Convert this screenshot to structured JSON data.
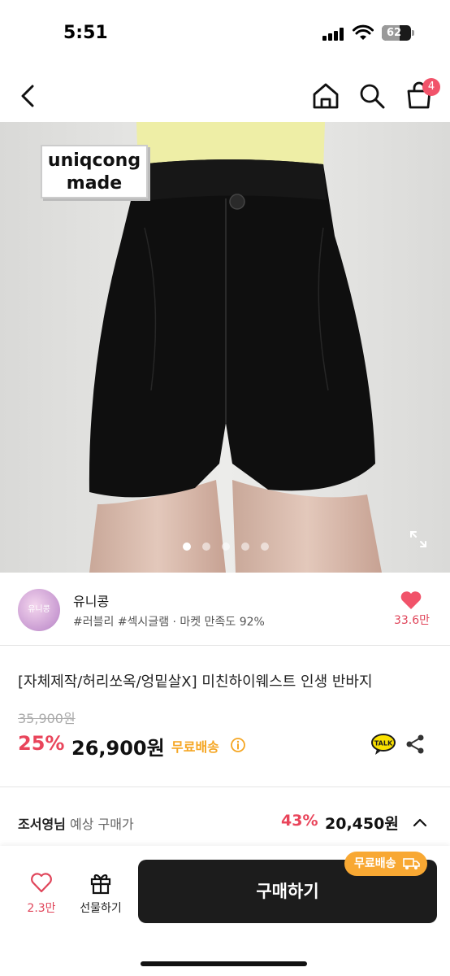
{
  "status_bar": {
    "time": "5:51",
    "battery": "62",
    "battery_level": 0.62
  },
  "nav": {
    "cart_count": "4"
  },
  "product_image": {
    "brand_line1": "uniqcong",
    "brand_line2": "made",
    "slide_count": 5,
    "active_slide": 0
  },
  "seller": {
    "avatar_text": "유니콩",
    "name": "유니콩",
    "tags": "#러블리 #섹시글램 · 마켓 만족도 92%",
    "likes": "33.6만"
  },
  "product": {
    "title": "[자체제작/허리쏘옥/엉밑살X] 미친하이웨스트 인생 반바지",
    "original_price": "35,900원",
    "discount": "25%",
    "price": "26,900원",
    "shipping": "무료배송"
  },
  "member_price": {
    "name": "조서영님",
    "label": "예상 구매가",
    "discount": "43%",
    "price": "20,450원"
  },
  "bottom_bar": {
    "wish_count": "2.3만",
    "gift_label": "선물하기",
    "buy_label": "구매하기",
    "free_badge": "무료배송"
  },
  "colors": {
    "accent_red": "#e9455b",
    "shipping_orange": "#f5a623",
    "buy_button": "#1c1c1c"
  }
}
